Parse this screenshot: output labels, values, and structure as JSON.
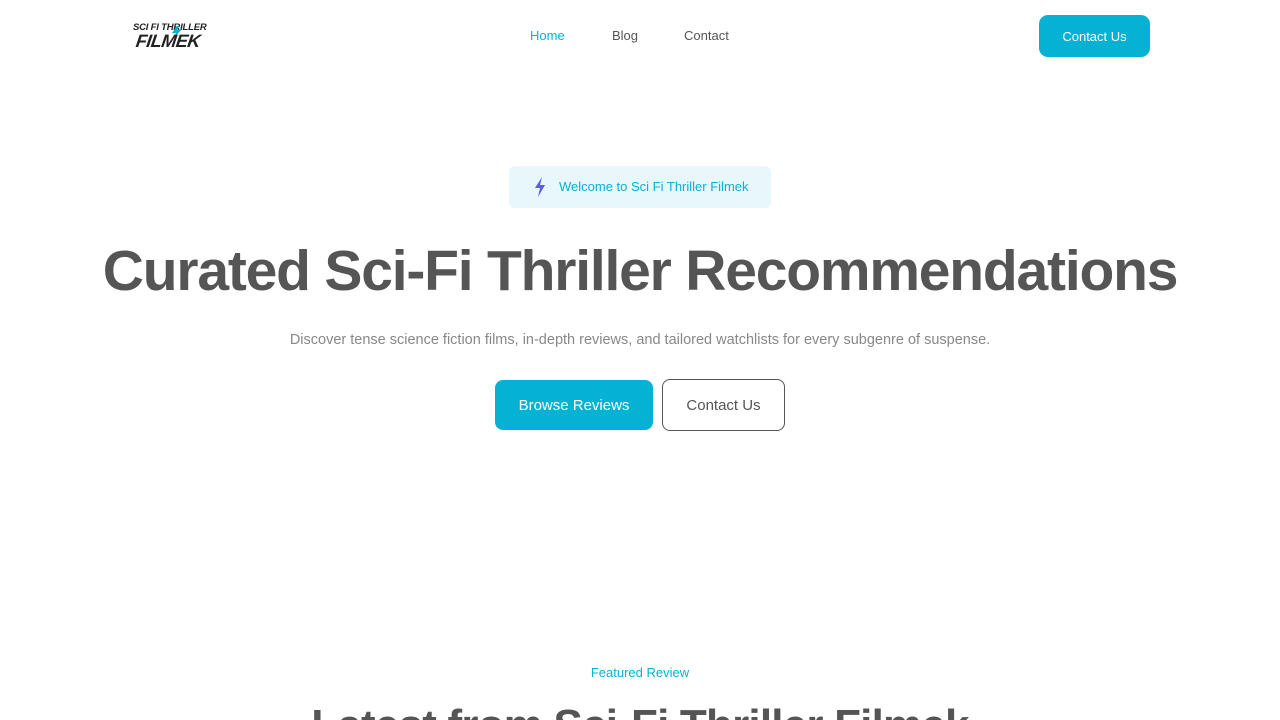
{
  "brand": {
    "logo_line1": "SCI FI THRILLER",
    "logo_line2": "FILMEK",
    "accent_color": "#06b2d4"
  },
  "nav": {
    "items": [
      {
        "label": "Home",
        "active": true
      },
      {
        "label": "Blog",
        "active": false
      },
      {
        "label": "Contact",
        "active": false
      }
    ],
    "cta_label": "Contact Us"
  },
  "hero": {
    "badge_icon": "lightning-bolt-icon",
    "badge_text": "Welcome to Sci Fi Thriller Filmek",
    "title": "Curated Sci-Fi Thriller Recommendations",
    "subtitle": "Discover tense science fiction films, in-depth reviews, and tailored watchlists for every subgenre of suspense.",
    "primary_button": "Browse Reviews",
    "secondary_button": "Contact Us"
  },
  "featured": {
    "label": "Featured Review",
    "title": "Latest from Sci-Fi Thriller Filmek"
  }
}
